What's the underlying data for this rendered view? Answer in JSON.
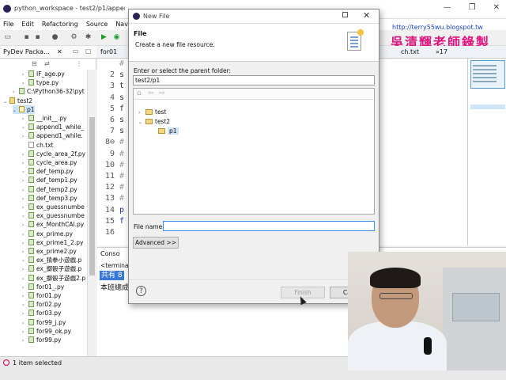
{
  "window": {
    "title": "python_workspace - test2/p1/append1_w",
    "controls": [
      "—",
      "❐",
      "✕"
    ]
  },
  "menu": [
    "File",
    "Edit",
    "Refactoring",
    "Source",
    "Navigate"
  ],
  "toolbar_icons": [
    "new-icon",
    "save-icon",
    "save-all-icon",
    "print-icon",
    "debug-icon",
    "run-icon",
    "build-icon",
    "run-green-icon"
  ],
  "overlay": {
    "blog_url": "http://terry55wu.blogspot.tw",
    "calligraphy": "吳清輝老師錄製"
  },
  "package_explorer": {
    "tab_label": "PyDev Packa...",
    "tab_close": "✕",
    "tree": [
      {
        "label": "IF_age.py",
        "type": "py",
        "indent": 2,
        "arrow": "›"
      },
      {
        "label": "type.py",
        "type": "py",
        "indent": 2,
        "arrow": "›"
      },
      {
        "label": "C:\\Python36-32\\pyt",
        "type": "py",
        "indent": 1,
        "arrow": "›"
      },
      {
        "label": "test2",
        "type": "proj",
        "indent": 0,
        "arrow": "⌄"
      },
      {
        "label": "p1",
        "type": "pkg",
        "indent": 1,
        "arrow": "⌄",
        "selected": true
      },
      {
        "label": "__init__.py",
        "type": "py",
        "indent": 2,
        "arrow": "›"
      },
      {
        "label": "append1_while_",
        "type": "py",
        "indent": 2,
        "arrow": "›"
      },
      {
        "label": "append1_while.",
        "type": "py",
        "indent": 2,
        "arrow": "›"
      },
      {
        "label": "ch.txt",
        "type": "txt",
        "indent": 2,
        "arrow": ""
      },
      {
        "label": "cycle_area_2f.py",
        "type": "py",
        "indent": 2,
        "arrow": "›"
      },
      {
        "label": "cycle_area.py",
        "type": "py",
        "indent": 2,
        "arrow": "›"
      },
      {
        "label": "def_temp.py",
        "type": "py",
        "indent": 2,
        "arrow": "›"
      },
      {
        "label": "def_temp1.py",
        "type": "py",
        "indent": 2,
        "arrow": "›"
      },
      {
        "label": "def_temp2.py",
        "type": "py",
        "indent": 2,
        "arrow": "›"
      },
      {
        "label": "def_temp3.py",
        "type": "py",
        "indent": 2,
        "arrow": "›"
      },
      {
        "label": "ex_guessnumbe",
        "type": "py",
        "indent": 2,
        "arrow": "›"
      },
      {
        "label": "ex_guessnumbe",
        "type": "py",
        "indent": 2,
        "arrow": "›"
      },
      {
        "label": "ex_MonthCAl.py",
        "type": "py",
        "indent": 2,
        "arrow": "›"
      },
      {
        "label": "ex_prime.py",
        "type": "py",
        "indent": 2,
        "arrow": "›"
      },
      {
        "label": "ex_prime1_2.py",
        "type": "py",
        "indent": 2,
        "arrow": "›"
      },
      {
        "label": "ex_prime2.py",
        "type": "py",
        "indent": 2,
        "arrow": "›"
      },
      {
        "label": "ex_猜拳小遊戲.p",
        "type": "py",
        "indent": 2,
        "arrow": "›"
      },
      {
        "label": "ex_擲骰子遊戲.p",
        "type": "py",
        "indent": 2,
        "arrow": "›"
      },
      {
        "label": "ex_擲骰子遊戲2.p",
        "type": "py",
        "indent": 2,
        "arrow": "›"
      },
      {
        "label": "for01_.py",
        "type": "py",
        "indent": 2,
        "arrow": "›"
      },
      {
        "label": "for01.py",
        "type": "py",
        "indent": 2,
        "arrow": "›"
      },
      {
        "label": "for02.py",
        "type": "py",
        "indent": 2,
        "arrow": "›"
      },
      {
        "label": "for03.py",
        "type": "py",
        "indent": 2,
        "arrow": "›"
      },
      {
        "label": "for99_j.py",
        "type": "py",
        "indent": 2,
        "arrow": "›"
      },
      {
        "label": "for99_ok.py",
        "type": "py",
        "indent": 2,
        "arrow": "›"
      },
      {
        "label": "for99.py",
        "type": "py",
        "indent": 2,
        "arrow": "›"
      }
    ]
  },
  "editor": {
    "tab_partial": "for01",
    "right_tab": "ch.txt",
    "right_tab_count": "»17",
    "lines": [
      {
        "no": "",
        "text": "#",
        "kind": "cmt"
      },
      {
        "no": "2",
        "text": "s",
        "kind": ""
      },
      {
        "no": "3",
        "text": "t",
        "kind": ""
      },
      {
        "no": "4",
        "text": "s",
        "kind": ""
      },
      {
        "no": "5",
        "text": "f",
        "kind": ""
      },
      {
        "no": "6",
        "text": "s",
        "kind": ""
      },
      {
        "no": "7",
        "text": "s",
        "kind": ""
      },
      {
        "no": "8⊖",
        "text": "#",
        "kind": "cmt"
      },
      {
        "no": "9",
        "text": "#",
        "kind": "cmt"
      },
      {
        "no": "10",
        "text": "#",
        "kind": "cmt"
      },
      {
        "no": "11",
        "text": "#",
        "kind": "cmt"
      },
      {
        "no": "12",
        "text": "#",
        "kind": "cmt"
      },
      {
        "no": "13",
        "text": "#",
        "kind": "cmt"
      },
      {
        "no": "14",
        "text": "p",
        "kind": "kw"
      },
      {
        "no": "15",
        "text": "f",
        "kind": "kw"
      },
      {
        "no": "16",
        "text": "",
        "kind": ""
      }
    ]
  },
  "console": {
    "tab_label": "Conso",
    "line1": "<terminat",
    "highlight": "共有 8",
    "line3": "本班總成"
  },
  "status": {
    "text": "1 item selected"
  },
  "dialog": {
    "caption": "New File",
    "close": "✕",
    "header_title": "File",
    "header_desc": "Create a new file resource.",
    "parent_label": "Enter or select the parent folder:",
    "parent_value": "test2/p1",
    "nav_icons": [
      "home-icon",
      "back-icon",
      "forward-icon"
    ],
    "tree": [
      {
        "label": "test",
        "indent": 0,
        "arrow": "›"
      },
      {
        "label": "test2",
        "indent": 0,
        "arrow": "⌄"
      },
      {
        "label": "p1",
        "indent": 1,
        "arrow": "",
        "selected": true
      }
    ],
    "filename_label": "File name:",
    "filename_value": "",
    "advanced_label": "Advanced >>",
    "help": "?",
    "finish_label": "Finish",
    "cancel_label": "Cancel"
  }
}
